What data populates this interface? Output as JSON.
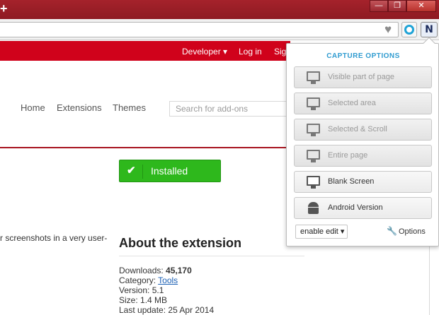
{
  "window": {
    "new_tab_label": "+",
    "controls": {
      "minimize": "—",
      "maximize": "❐",
      "close": "✕"
    }
  },
  "toolbar": {
    "heart_icon": "heart-icon",
    "ext1_icon": "circle-extension-icon",
    "ext2_label": "N"
  },
  "page": {
    "top_nav": {
      "developer": "Developer ▾",
      "login": "Log in",
      "signup": "Sig"
    },
    "main_nav": [
      "Home",
      "Extensions",
      "Themes"
    ],
    "search_placeholder": "Search for add-ons",
    "install_button": {
      "check": "✔",
      "label": "Installed"
    },
    "description_fragment": "r screenshots in a very user-",
    "about_title": "About the extension",
    "details": {
      "downloads_label": "Downloads:",
      "downloads_value": "45,170",
      "category_label": "Category:",
      "category_value": "Tools",
      "version_label": "Version:",
      "version_value": "5.1",
      "size_label": "Size:",
      "size_value": "1.4 MB",
      "updated_label": "Last update:",
      "updated_value": "25 Apr 2014"
    }
  },
  "popup": {
    "title": "CAPTURE OPTIONS",
    "options": [
      {
        "label": "Visible part of page",
        "enabled": false
      },
      {
        "label": "Selected area",
        "enabled": false
      },
      {
        "label": "Selected & Scroll",
        "enabled": false
      },
      {
        "label": "Entire page",
        "enabled": false
      },
      {
        "label": "Blank Screen",
        "enabled": true
      },
      {
        "label": "Android Version",
        "enabled": true
      }
    ],
    "edit_select": "enable edit ▾",
    "options_link": "Options",
    "colors": {
      "accent": "#2f9bd0",
      "brand_red": "#d0021b",
      "install_green": "#2eb81c"
    }
  }
}
